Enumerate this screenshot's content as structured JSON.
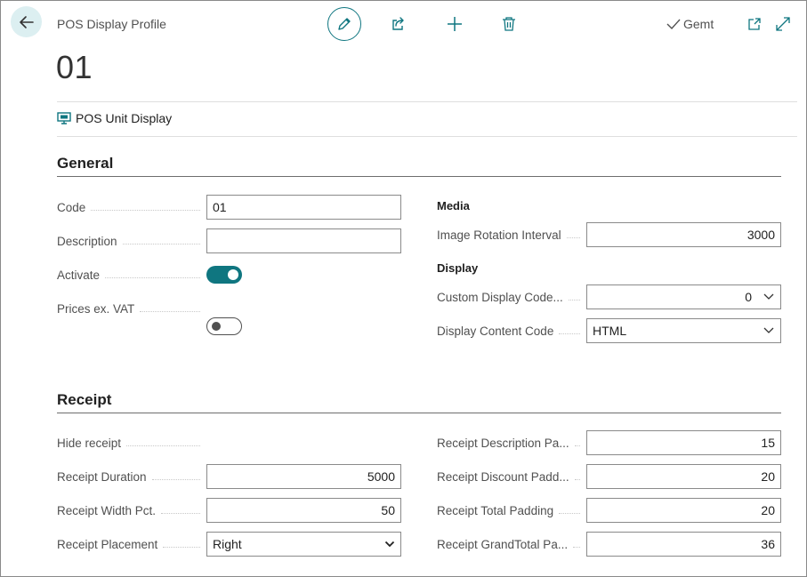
{
  "header": {
    "caption": "POS Display Profile",
    "record_title": "01",
    "saved_status": "Gemt"
  },
  "navigation": {
    "pos_unit_display": "POS Unit Display"
  },
  "sections": {
    "general": {
      "title": "General",
      "code": {
        "label": "Code",
        "value": "01"
      },
      "description": {
        "label": "Description",
        "value": ""
      },
      "activate": {
        "label": "Activate",
        "checked": true
      },
      "prices_ex_vat": {
        "label": "Prices ex. VAT",
        "checked": false
      },
      "media": {
        "title": "Media",
        "image_rotation_interval": {
          "label": "Image Rotation Interval",
          "value": "3000"
        }
      },
      "display": {
        "title": "Display",
        "custom_display_codeunit": {
          "label": "Custom Display Code...",
          "value": "0"
        },
        "display_content_code": {
          "label": "Display Content Code",
          "value": "HTML"
        }
      }
    },
    "receipt": {
      "title": "Receipt",
      "hide_receipt": {
        "label": "Hide receipt",
        "checked": false
      },
      "receipt_duration": {
        "label": "Receipt Duration",
        "value": "5000"
      },
      "receipt_width_pct": {
        "label": "Receipt Width Pct.",
        "value": "50"
      },
      "receipt_placement": {
        "label": "Receipt Placement",
        "value": "Right"
      },
      "receipt_description_padding": {
        "label": "Receipt Description Pa...",
        "value": "15"
      },
      "receipt_discount_padding": {
        "label": "Receipt Discount Padd...",
        "value": "20"
      },
      "receipt_total_padding": {
        "label": "Receipt Total Padding",
        "value": "20"
      },
      "receipt_grandtotal_padding": {
        "label": "Receipt GrandTotal Pa...",
        "value": "36"
      }
    }
  },
  "colors": {
    "accent": "#0f7680",
    "back_button_bg": "#dceff1"
  },
  "icons": {
    "back": "arrow-left-icon",
    "edit": "pencil-icon",
    "share": "share-icon",
    "new": "plus-icon",
    "delete": "trash-icon",
    "saved": "checkmark-icon",
    "open_new_window": "open-in-new-window-icon",
    "expand": "expand-icon",
    "display": "monitor-icon"
  }
}
